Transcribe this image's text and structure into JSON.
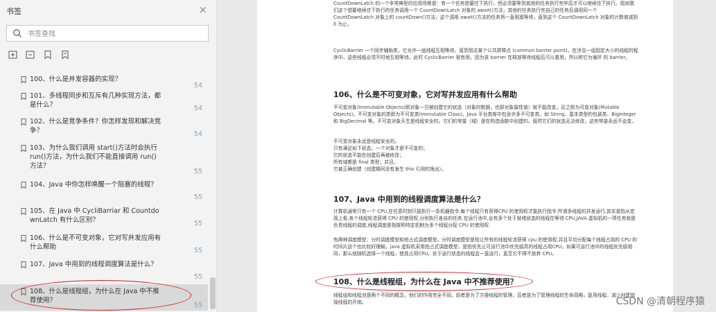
{
  "sidebar": {
    "title": "书签",
    "close_icon": "×",
    "search": {
      "placeholder": "书签查找",
      "value": ""
    },
    "toolbar": [
      "expand-all-icon",
      "collapse-all-icon",
      "add-bookmark-icon",
      "delete-bookmark-icon"
    ],
    "items": [
      {
        "label": "100、什么是并发容器的实现？",
        "page": "54"
      },
      {
        "label": "101、多线程同步和互斥有几种实现方法，都是什么？",
        "page": "54"
      },
      {
        "label": "102、什么是竞争条件？你怎样发现和解决竞争？",
        "page": "54"
      },
      {
        "label": "103、为什么我们调用 start()方法时会执行 run()方法，为什么我们不能直接调用 run()方法？",
        "page": "55"
      },
      {
        "label": "104、Java 中你怎样唤醒一个阻塞的线程？",
        "page": "55"
      },
      {
        "label": "105、在 Java 中 CycliBarriar 和 CountdownLatch 有什么区别？",
        "page": "55"
      },
      {
        "label": "106、什么是不可变对象，它对写并发应用有什么帮助",
        "page": "55"
      },
      {
        "label": "107、Java 中用到的线程调度算法是什么？",
        "page": "55"
      },
      {
        "label": "108、什么是线程组，为什么在 Java 中不推荐使用？",
        "page": "55"
      }
    ]
  },
  "document": {
    "p1": "CountDownLatch 的一个非常典型的应用场景是：有一个任务想要往下执行，但必须要等到其他的任务执行完毕后才可以继续往下执行。假如我们这个想要继续往下执行的任务调用一个 CountDownLatch 对象的 await()方法，其他的任务执行完自己的任务后调用同一个 CountDownLatch 对象上的 countDown()方法，这个调用 await()方法的任务将一直阻塞等待，直到这个 CountDownLatch 对象的计数值减到 0 为止。",
    "p2": "CyclicBarrier 一个同步辅助类，它允许一组线程互相等待，直到到达某个公共屏障点 (common barrier point)。在涉及一组固定大小的线程的程序中，这些线程必须不时地互相等待，此时 CyclicBarrier 很有用。因为该 barrier 在释放等待线程后可以重用，所以称它为循环 的 barrier。",
    "h106": "106、什么是不可变对象，它对写并发应用有什么帮助",
    "p3": "不可变对象(Immutable Objects)即对象一旦被创建它的状态（对象的数据，也即对象属性值）就不能改变，反之即为可变对象(Mutable Objects)。不可变对象的类即为不可变类(Immutable Class)。Java 平台类库中包含许多不可变类，如 String、基本类型的包装类、BigInteger 和 BigDecimal 等。不可变对象天生是线程安全的。它们的常量（域）是在构造函数中创建的。既然它们的状态无法修改，这些常量永远不会变。",
    "p4": "不可变对象永远是线程安全的。\n只有满足如下状态，一个对象才是不可变的；\n它的状态不能在创建后再被修改；\n所有域都是 final 类型；并且，\n它被正确创建（创建期间没有发生 this 引用的逸出）。",
    "h107": "107、Java 中用到的线程调度算法是什么？",
    "p5": "计算机通常只有一个 CPU,在任意时刻只能执行一条机器指令,每个线程只有获得CPU 的使用权才能执行指令.所谓多线程的并发运行,其实是指从宏观上看,各个线程轮流获得 CPU 的使用权,分别执行各自的任务.在运行池中,会有多个处于就绪状态的线程在等待 CPU,JAVA 虚拟机的一项任务就是负责线程的调度,线程调度是指按照特定机制为多个线程分配 CPU 的使用权.",
    "p6": "有两种调度模型：分时调度模型和抢占式调度模型。分时调度模型是指让所有的线程轮流获得 cpu 的使用权,并且平均分配每个线程占用的 CPU 的时间片这个也比较好理解。java 虚拟机采用抢占式调度模型，是指优先让可运行池中优先级高的线程占用CPU，如果可运行池中的线程优先级相同，那么就随机选择一个线程，使其占用CPU。处于运行状态的线程会一直运行，直至它不得不放弃 CPU。",
    "h108": "108、什么是线程组，为什么在 Java 中不推荐使用？",
    "p7": "线程组和线程池是两个不同的概念，他们的作用完全不同，前者是为了方便线程的管理，后者是为了管理线程的生命周期，复用线程，减少创建销毁线程的开销。"
  },
  "watermark": "CSDN @清朝程序猿",
  "colors": {
    "annotation": "#d12020",
    "page_number": "#8aa0b3"
  }
}
